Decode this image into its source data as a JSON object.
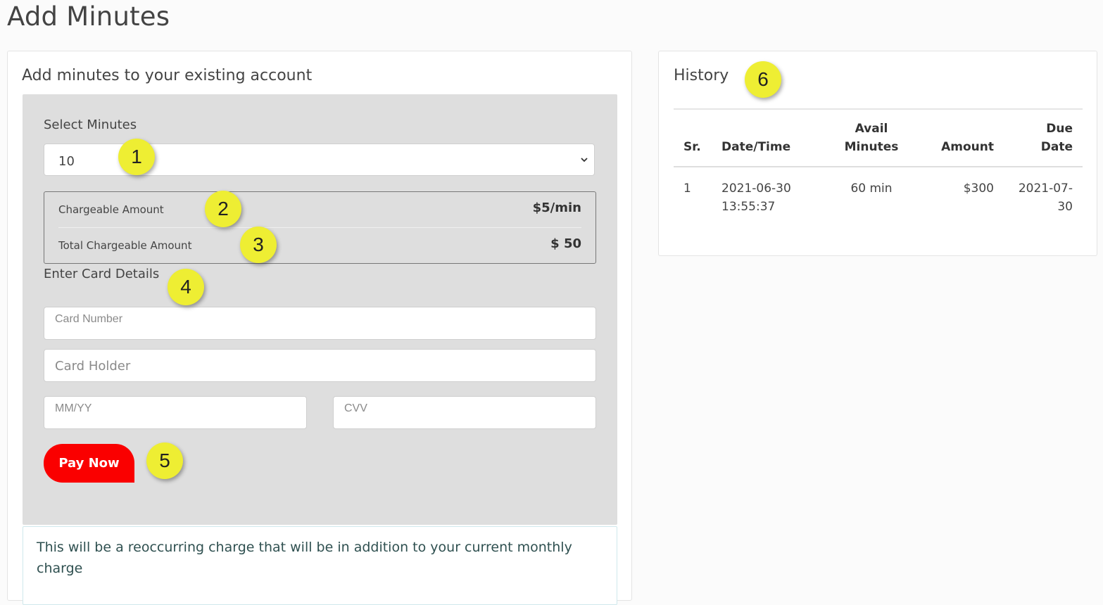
{
  "page": {
    "title": "Add Minutes"
  },
  "add_minutes": {
    "heading": "Add minutes to your existing account",
    "select_label": "Select Minutes",
    "selected_minutes": "10",
    "chargeable_label": "Chargeable Amount",
    "chargeable_value": "$5/min",
    "total_label": "Total Chargeable Amount",
    "total_value": "$ 50",
    "card_section_label": "Enter Card Details",
    "card_number_placeholder": "Card Number",
    "card_holder_placeholder": "Card Holder",
    "expiry_placeholder": "MM/YY",
    "cvv_placeholder": "CVV",
    "pay_button": "Pay Now",
    "notice": "This will be a reoccurring charge that will be in addition to your current monthly charge"
  },
  "history": {
    "heading": "History",
    "columns": [
      "Sr.",
      "Date/Time",
      "Avail Minutes",
      "Amount",
      "Due Date"
    ],
    "rows": [
      {
        "sr": "1",
        "datetime": "2021-06-30 13:55:37",
        "minutes": "60 min",
        "amount": "$300",
        "due": "2021-07-30"
      }
    ]
  },
  "annotations": [
    "1",
    "2",
    "3",
    "4",
    "5",
    "6"
  ],
  "colors": {
    "pay_button": "#fa0000",
    "panel": "#dedede",
    "badge": "#eeee33"
  }
}
